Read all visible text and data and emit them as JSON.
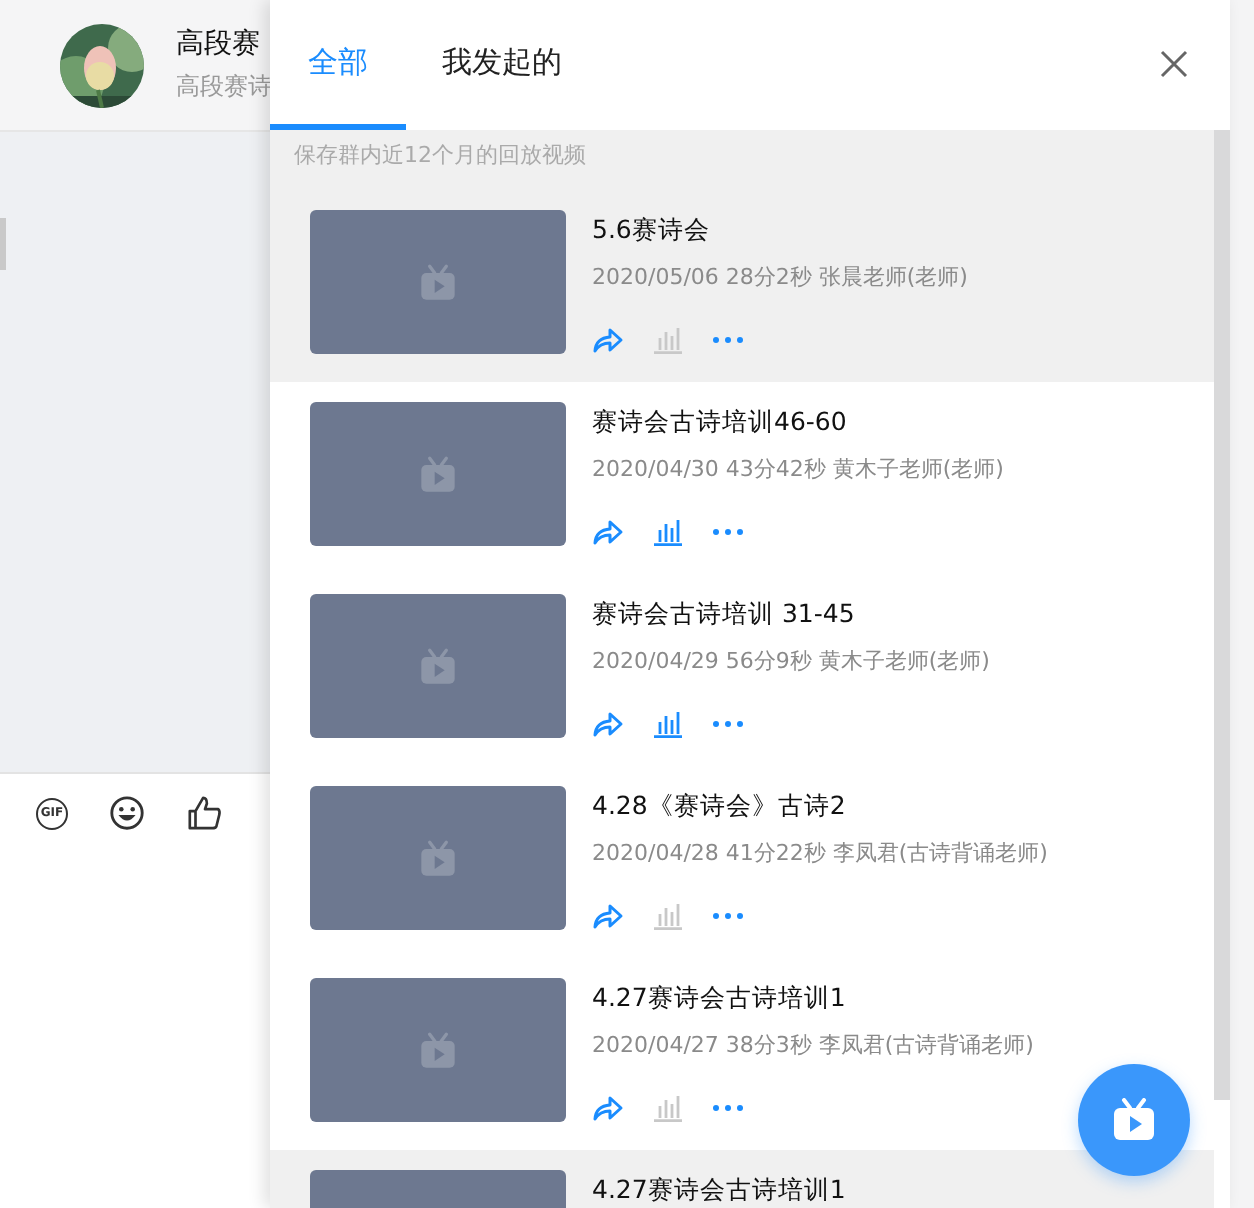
{
  "chat": {
    "title": "高段赛",
    "subtitle": "高段赛诗",
    "toolbar": {
      "gif_label": "GIF"
    }
  },
  "panel": {
    "tabs": [
      {
        "label": "全部",
        "selected": true
      },
      {
        "label": "我发起的",
        "selected": false
      }
    ],
    "hint": "保存群内近12个月的回放视频",
    "videos": [
      {
        "title": "5.6赛诗会",
        "meta": "2020/05/06 28分2秒 张晨老师(老师)",
        "stats_enabled": false,
        "selected": true
      },
      {
        "title": "赛诗会古诗培训46-60",
        "meta": "2020/04/30 43分42秒 黄木子老师(老师)",
        "stats_enabled": true,
        "selected": false
      },
      {
        "title": "赛诗会古诗培训 31-45",
        "meta": "2020/04/29 56分9秒 黄木子老师(老师)",
        "stats_enabled": true,
        "selected": false
      },
      {
        "title": "4.28《赛诗会》古诗2",
        "meta": "2020/04/28 41分22秒 李凤君(古诗背诵老师)",
        "stats_enabled": false,
        "selected": false
      },
      {
        "title": "4.27赛诗会古诗培训1",
        "meta": "2020/04/27 38分3秒 李凤君(古诗背诵老师)",
        "stats_enabled": false,
        "selected": false
      },
      {
        "title": "4.27赛诗会古诗培训1",
        "selected": true
      }
    ]
  }
}
